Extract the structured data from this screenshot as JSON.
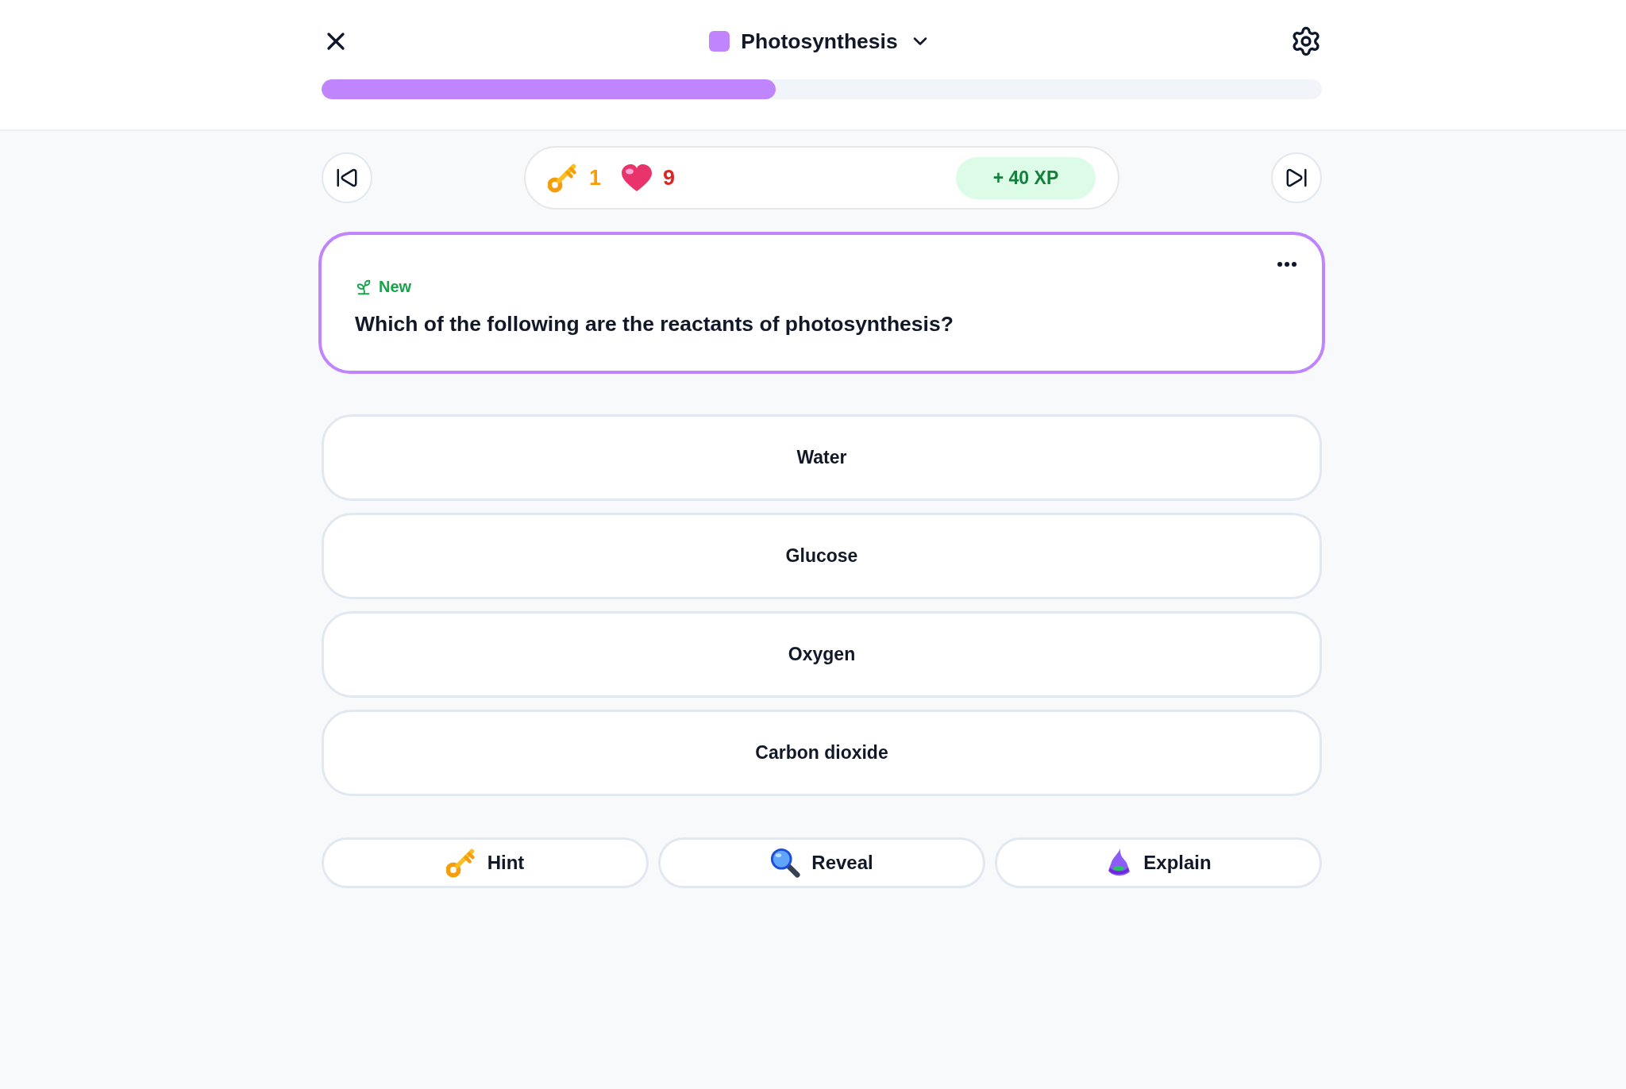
{
  "header": {
    "topic": "Photosynthesis",
    "progress": {
      "level": 0.454
    }
  },
  "stats": {
    "keys": "1",
    "hearts": "9",
    "xp": "+ 40 XP"
  },
  "question": {
    "tag": "New",
    "text": "Which of the following are the reactants of photosynthesis?"
  },
  "options": [
    {
      "label": "Water",
      "selected": false
    },
    {
      "label": "Glucose",
      "selected": false
    },
    {
      "label": "Oxygen",
      "selected": false
    },
    {
      "label": "Carbon dioxide",
      "selected": false
    }
  ],
  "actions": [
    {
      "kind": "hint",
      "label": "Hint"
    },
    {
      "kind": "reveal",
      "label": "Reveal"
    },
    {
      "kind": "explain",
      "label": "Explain"
    }
  ]
}
